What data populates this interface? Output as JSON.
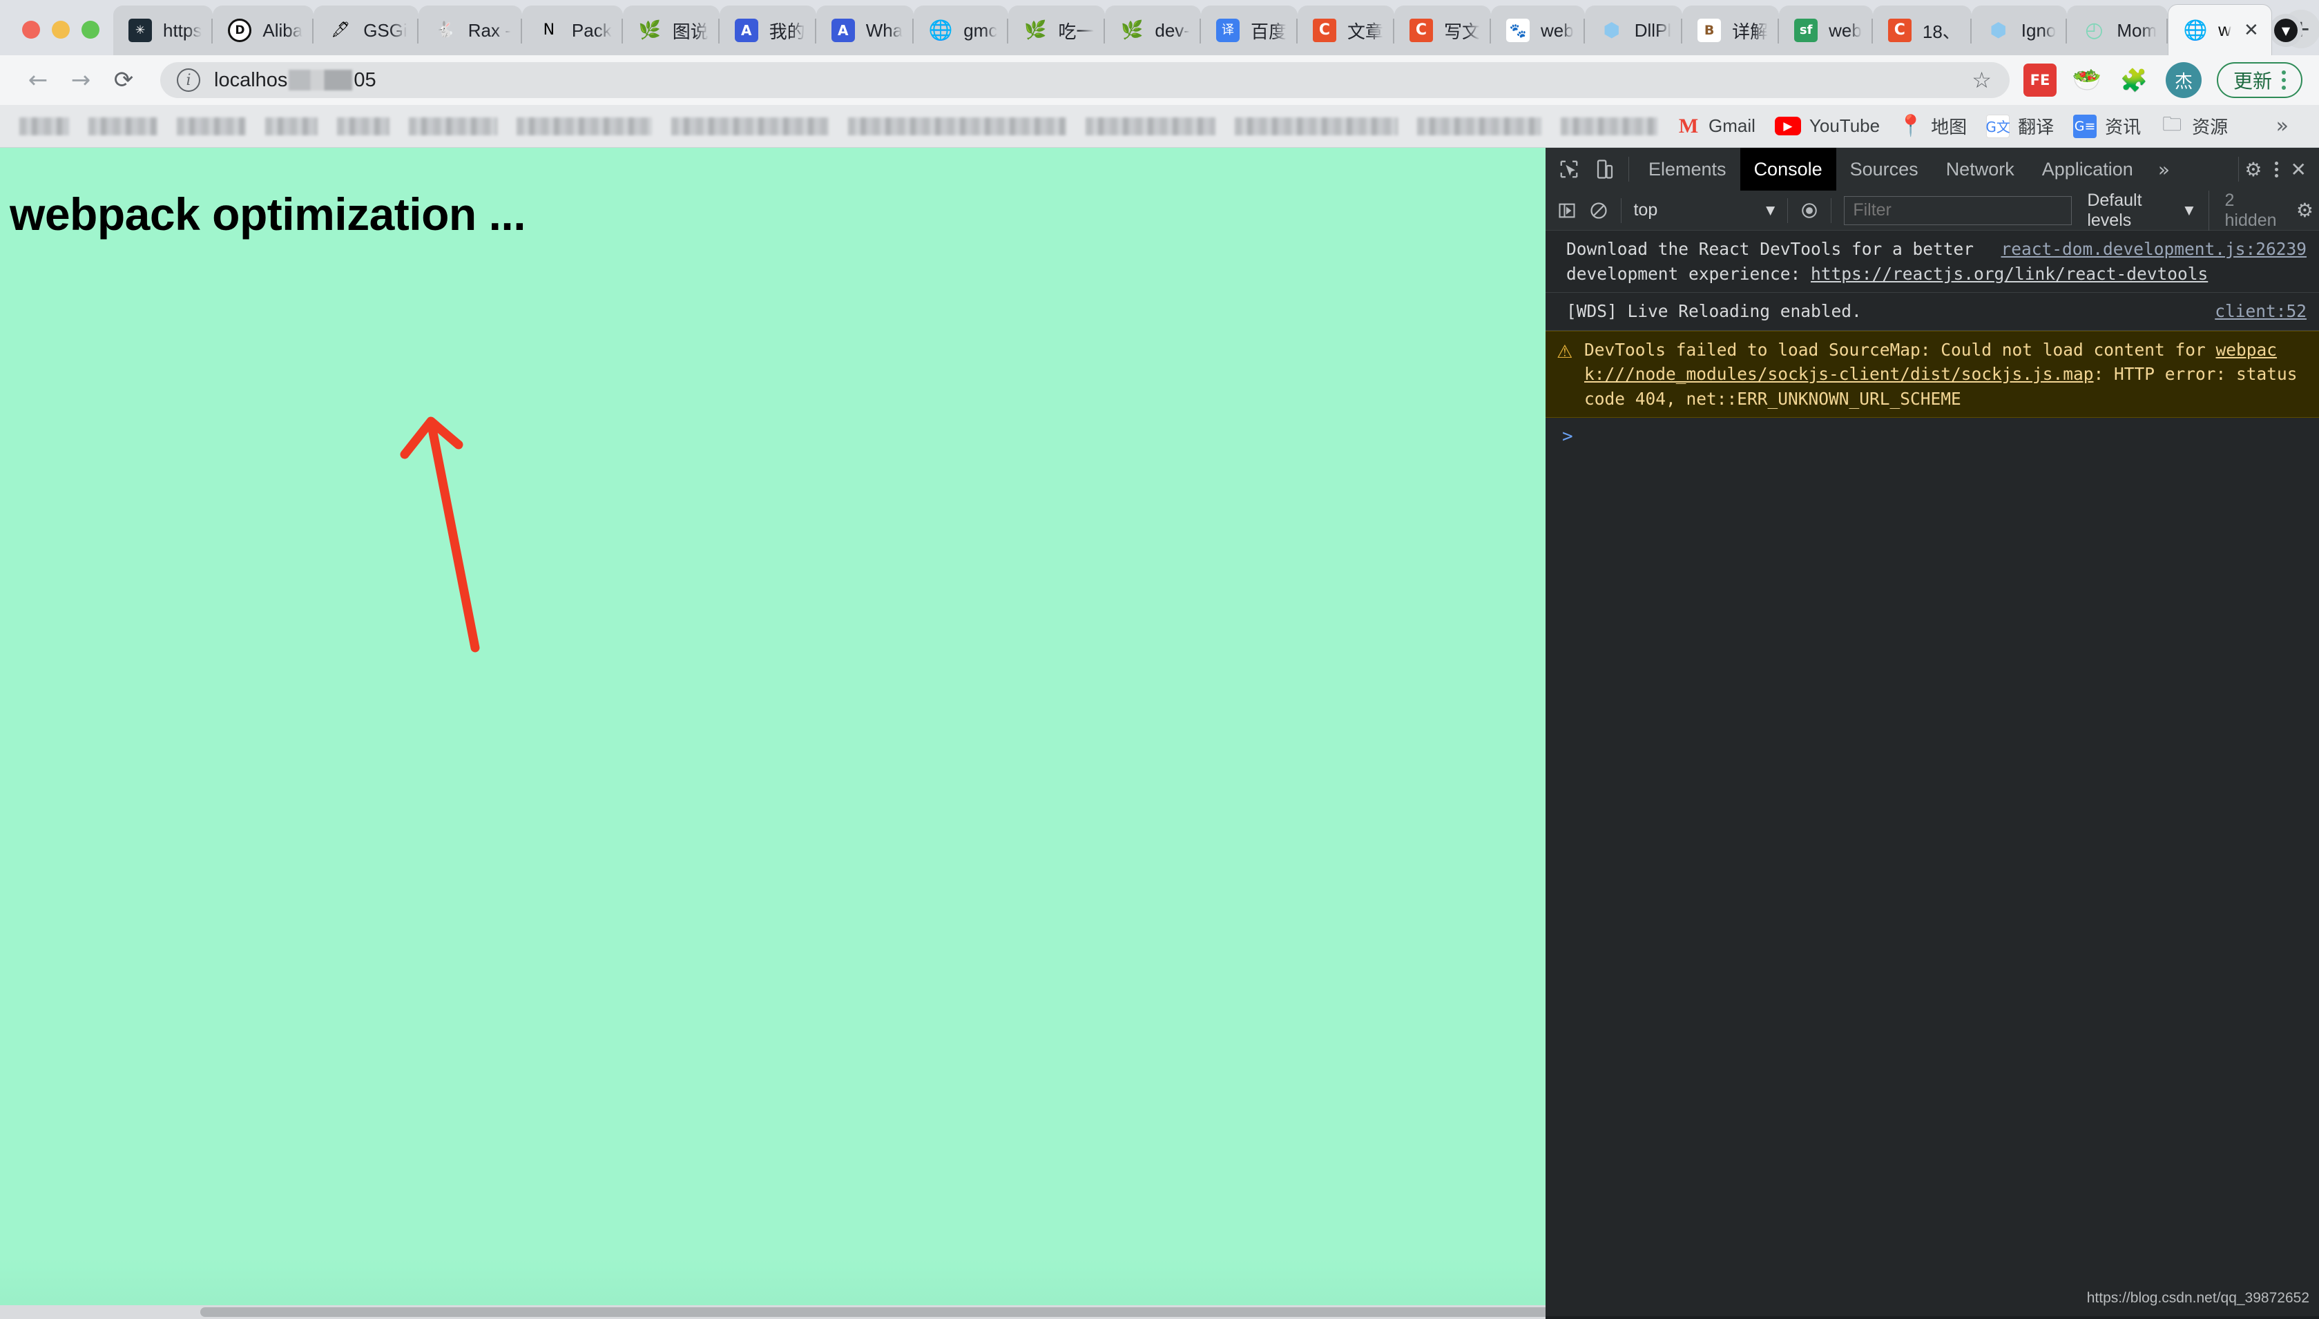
{
  "window": {
    "traffic_lights": [
      "close",
      "minimize",
      "maximize"
    ]
  },
  "tabs": [
    {
      "title": "https",
      "icon": "medusa-icon",
      "glyph": "✳",
      "style": "fi-medusa"
    },
    {
      "title": "Aliba",
      "icon": "dingtalk-icon",
      "glyph": "D",
      "style": "fi-circle-d"
    },
    {
      "title": "GSGi",
      "icon": "feather-icon",
      "glyph": "🖋",
      "style": "fi-plain"
    },
    {
      "title": "Rax -",
      "icon": "rax-icon",
      "glyph": "🐇",
      "style": "fi-plain"
    },
    {
      "title": "Pack",
      "icon": "nuxt-n-icon",
      "glyph": "N",
      "style": "fi-plain"
    },
    {
      "title": "图说",
      "icon": "leaf-icon",
      "glyph": "🌿",
      "style": "fi-leaf"
    },
    {
      "title": "我的",
      "icon": "a-square-icon",
      "glyph": "A",
      "style": "fi-blue-sq"
    },
    {
      "title": "Wha",
      "icon": "a-square-icon",
      "glyph": "A",
      "style": "fi-blue-sq"
    },
    {
      "title": "gmc",
      "icon": "globe-icon",
      "glyph": "🌐",
      "style": "fi-globe"
    },
    {
      "title": "吃一",
      "icon": "leaf-orange-icon",
      "glyph": "🌿",
      "style": "fi-leaf-orange"
    },
    {
      "title": "dev-",
      "icon": "leaf-icon",
      "glyph": "🌿",
      "style": "fi-leaf"
    },
    {
      "title": "百度",
      "icon": "translate-icon",
      "glyph": "译",
      "style": "fi-blue-tr"
    },
    {
      "title": "文章",
      "icon": "csdn-icon",
      "glyph": "C",
      "style": "fi-orange-sq"
    },
    {
      "title": "写文",
      "icon": "csdn-icon",
      "glyph": "C",
      "style": "fi-orange-sq"
    },
    {
      "title": "web",
      "icon": "baidu-icon",
      "glyph": "🐾",
      "style": "fi-baidu"
    },
    {
      "title": "DllPl",
      "icon": "webpack-cube-icon",
      "glyph": "⬢",
      "style": "fi-cube"
    },
    {
      "title": "详解",
      "icon": "juejin-icon",
      "glyph": "B",
      "style": "fi-juejin"
    },
    {
      "title": "web",
      "icon": "segmentfault-icon",
      "glyph": "sf",
      "style": "fi-green-sq"
    },
    {
      "title": "18、",
      "icon": "csdn-icon",
      "glyph": "C",
      "style": "fi-orange-sq"
    },
    {
      "title": "Igno",
      "icon": "webpack-cube-icon",
      "glyph": "⬢",
      "style": "fi-cube"
    },
    {
      "title": "Mom",
      "icon": "clock-icon",
      "glyph": "◴",
      "style": "fi-clock"
    }
  ],
  "active_tab": {
    "title": "w",
    "icon": "globe-icon",
    "glyph": "🌐",
    "close_label": "✕"
  },
  "newtab_label": "+",
  "tabstrip_chevron": "▼",
  "toolbar": {
    "back_label": "←",
    "forward_label": "→",
    "reload_label": "⟳",
    "info_label": "i",
    "url_prefix": "localhos",
    "url_suffix": "05",
    "star_label": "☆",
    "extensions": [
      {
        "name": "fe-extension-icon",
        "glyph": "FE",
        "style": "ext-fe"
      },
      {
        "name": "bowl-extension-icon",
        "glyph": "🥗",
        "style": "ext-bowl"
      },
      {
        "name": "puzzle-extensions-icon",
        "glyph": "🧩",
        "style": "ext-puzzle"
      }
    ],
    "avatar_label": "杰",
    "update_label": "更新"
  },
  "bookmarks": {
    "items": [
      {
        "label": "Gmail",
        "icon": "gmail-icon",
        "glyph": "M",
        "style": "bm-gmail"
      },
      {
        "label": "YouTube",
        "icon": "youtube-icon",
        "glyph": "▶",
        "style": "bm-yt"
      },
      {
        "label": "地图",
        "icon": "maps-pin-icon",
        "glyph": "📍",
        "style": "bm-maps"
      },
      {
        "label": "翻译",
        "icon": "translate-icon",
        "glyph": "G文",
        "style": "bm-tr"
      },
      {
        "label": "资讯",
        "icon": "news-icon",
        "glyph": "G≡",
        "style": "bm-news"
      },
      {
        "label": "资源",
        "icon": "folder-icon",
        "glyph": "🗀",
        "style": "bm-folder"
      }
    ],
    "overflow_label": "»"
  },
  "page": {
    "heading": "webpack optimization ...",
    "background_color": "#a0f5cd",
    "annotation": {
      "type": "arrow",
      "color": "#f03a22"
    }
  },
  "devtools": {
    "inspect_icon": "cursor-select-icon",
    "device_icon": "device-toolbar-icon",
    "tabs": [
      {
        "label": "Elements",
        "active": false
      },
      {
        "label": "Console",
        "active": true
      },
      {
        "label": "Sources",
        "active": false
      },
      {
        "label": "Network",
        "active": false
      },
      {
        "label": "Application",
        "active": false
      }
    ],
    "more_tabs_label": "»",
    "settings_label": "⚙",
    "close_label": "✕",
    "filterbar": {
      "sidebar_toggle": "▶",
      "clear_label": "⃠",
      "context": "top",
      "context_caret": "▼",
      "eye_label": "◉",
      "filter_placeholder": "Filter",
      "levels_label": "Default levels",
      "levels_caret": "▼",
      "hidden_label": "2 hidden",
      "settings_gear": "⚙"
    },
    "messages": [
      {
        "type": "info",
        "source": "react-dom.development.js:26239",
        "text_before": "Download the React DevTools for a better development experience: ",
        "link": "https://reactjs.org/link/react-devtools"
      },
      {
        "type": "info",
        "source": "client:52",
        "text_before": "[WDS] Live Reloading enabled.",
        "link": ""
      },
      {
        "type": "warning",
        "icon": "warning-triangle-icon",
        "glyph": "⚠",
        "source": "",
        "text_before": "DevTools failed to load SourceMap: Could not load content for ",
        "link": "webpack:///node_modules/sockjs-client/dist/sockjs.js.map",
        "text_after": ": HTTP error: status code 404, net::ERR_UNKNOWN_URL_SCHEME"
      }
    ],
    "prompt_symbol": ">",
    "watermark": "https://blog.csdn.net/qq_39872652"
  }
}
